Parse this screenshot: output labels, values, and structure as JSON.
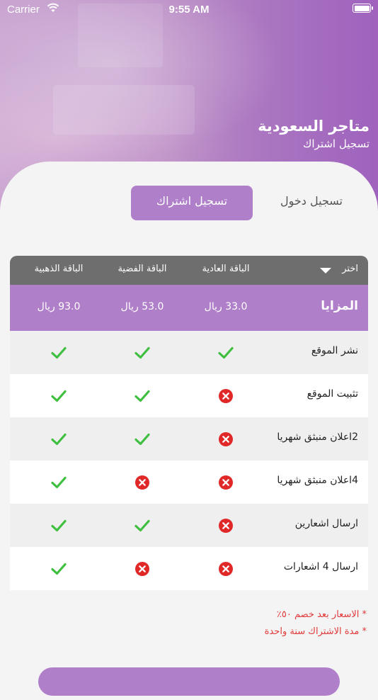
{
  "status_bar": {
    "carrier": "Carrier",
    "time": "9:55 AM"
  },
  "header": {
    "title": "متاجر السعودية",
    "subtitle": "تسجيل اشتراك"
  },
  "tabs": [
    {
      "label": "تسجيل اشتراك",
      "active": true
    },
    {
      "label": "تسجيل دخول",
      "active": false
    }
  ],
  "table": {
    "select_label": "اختر",
    "columns": [
      "الباقة العادية",
      "الباقة الفضية",
      "الباقة الذهبية"
    ],
    "price_label": "المزايا",
    "prices": [
      "33.0 ريال",
      "53.0 ريال",
      "93.0 ريال"
    ],
    "rows": [
      {
        "feature": "نشر الموقع",
        "values": [
          true,
          true,
          true
        ]
      },
      {
        "feature": "تثبيت الموقع",
        "values": [
          false,
          true,
          true
        ]
      },
      {
        "feature": "2اعلان منبثق شهريا",
        "values": [
          false,
          true,
          true
        ]
      },
      {
        "feature": "4اعلان منبثق شهريا",
        "values": [
          false,
          false,
          true
        ]
      },
      {
        "feature": "ارسال اشعارين",
        "values": [
          false,
          true,
          true
        ]
      },
      {
        "feature": "ارسال 4 اشعارات",
        "values": [
          false,
          false,
          true
        ]
      }
    ]
  },
  "notes": [
    "* الاسعار بعد خصم ٥٠٪",
    "* مدة الاشتراك سنة واحدة"
  ],
  "colors": {
    "accent": "#b07fc9",
    "check": "#3fbf3f",
    "cross": "#e02828",
    "note": "#e23a3a"
  }
}
